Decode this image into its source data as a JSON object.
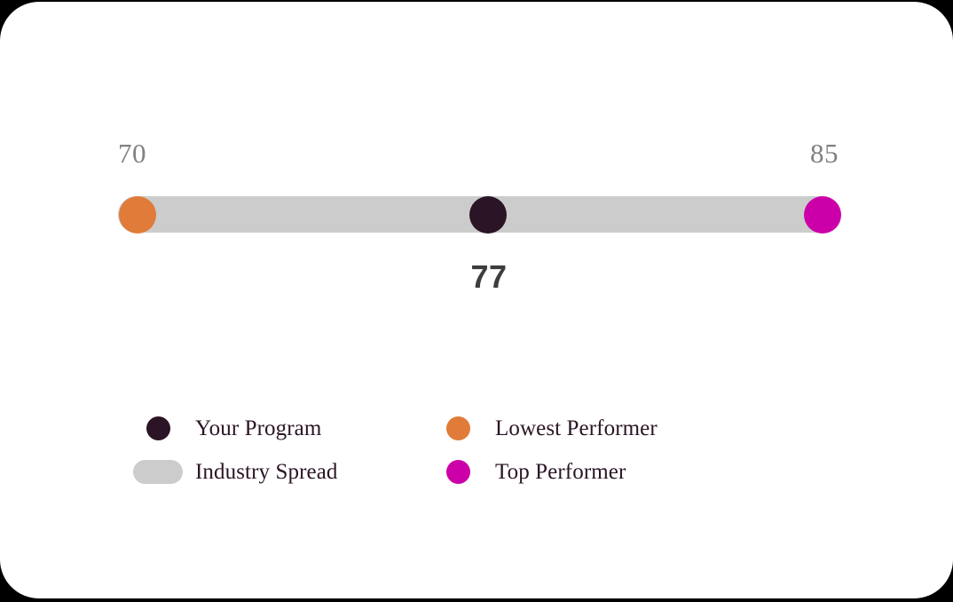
{
  "chart_data": {
    "type": "bar",
    "title": "",
    "subtitle": "",
    "xlabel": "",
    "ylabel": "",
    "orientation": "horizontal",
    "axis_min_label": "70",
    "axis_max_label": "85",
    "xlim": [
      70,
      85
    ],
    "grid": false,
    "legend_position": "bottom",
    "value_label": "77",
    "categories": [
      "Lowest Performer",
      "Your Program",
      "Top Performer"
    ],
    "values": [
      70,
      77,
      85
    ],
    "series": [
      {
        "name": "Industry Spread",
        "type": "range",
        "values": [
          70,
          85
        ],
        "color": "#CCCCCC"
      },
      {
        "name": "Lowest Performer",
        "type": "point",
        "values": [
          70
        ],
        "color": "#E07B39"
      },
      {
        "name": "Your Program",
        "type": "point",
        "values": [
          77
        ],
        "color": "#2B1425"
      },
      {
        "name": "Top Performer",
        "type": "point",
        "values": [
          85
        ],
        "color": "#CC00A8"
      }
    ],
    "annotations": [
      {
        "text": "70",
        "position": "axis-min"
      },
      {
        "text": "85",
        "position": "axis-max"
      },
      {
        "text": "77",
        "position": "below-your-program-marker"
      }
    ]
  },
  "scale": {
    "min_label": "70",
    "max_label": "85"
  },
  "value": {
    "your_program": "77"
  },
  "legend": {
    "items": [
      {
        "label": "Your Program",
        "color": "#2B1425",
        "shape": "circle",
        "icon": "legend-dot-icon"
      },
      {
        "label": "Lowest Performer",
        "color": "#E07B39",
        "shape": "circle",
        "icon": "legend-dot-icon"
      },
      {
        "label": "Industry Spread",
        "color": "#CCCCCC",
        "shape": "pill",
        "icon": "legend-pill-icon"
      },
      {
        "label": "Top Performer",
        "color": "#CC00A8",
        "shape": "circle",
        "icon": "legend-dot-icon"
      }
    ]
  },
  "colors": {
    "card_background": "#FFFFFF",
    "page_background": "#000000",
    "track": "#CCCCCC",
    "your_program": "#2B1425",
    "lowest_performer": "#E07B39",
    "top_performer": "#CC00A8",
    "range_label_text": "#808080",
    "value_label_text": "#3D3D3D",
    "legend_label_text": "#2B1425"
  }
}
